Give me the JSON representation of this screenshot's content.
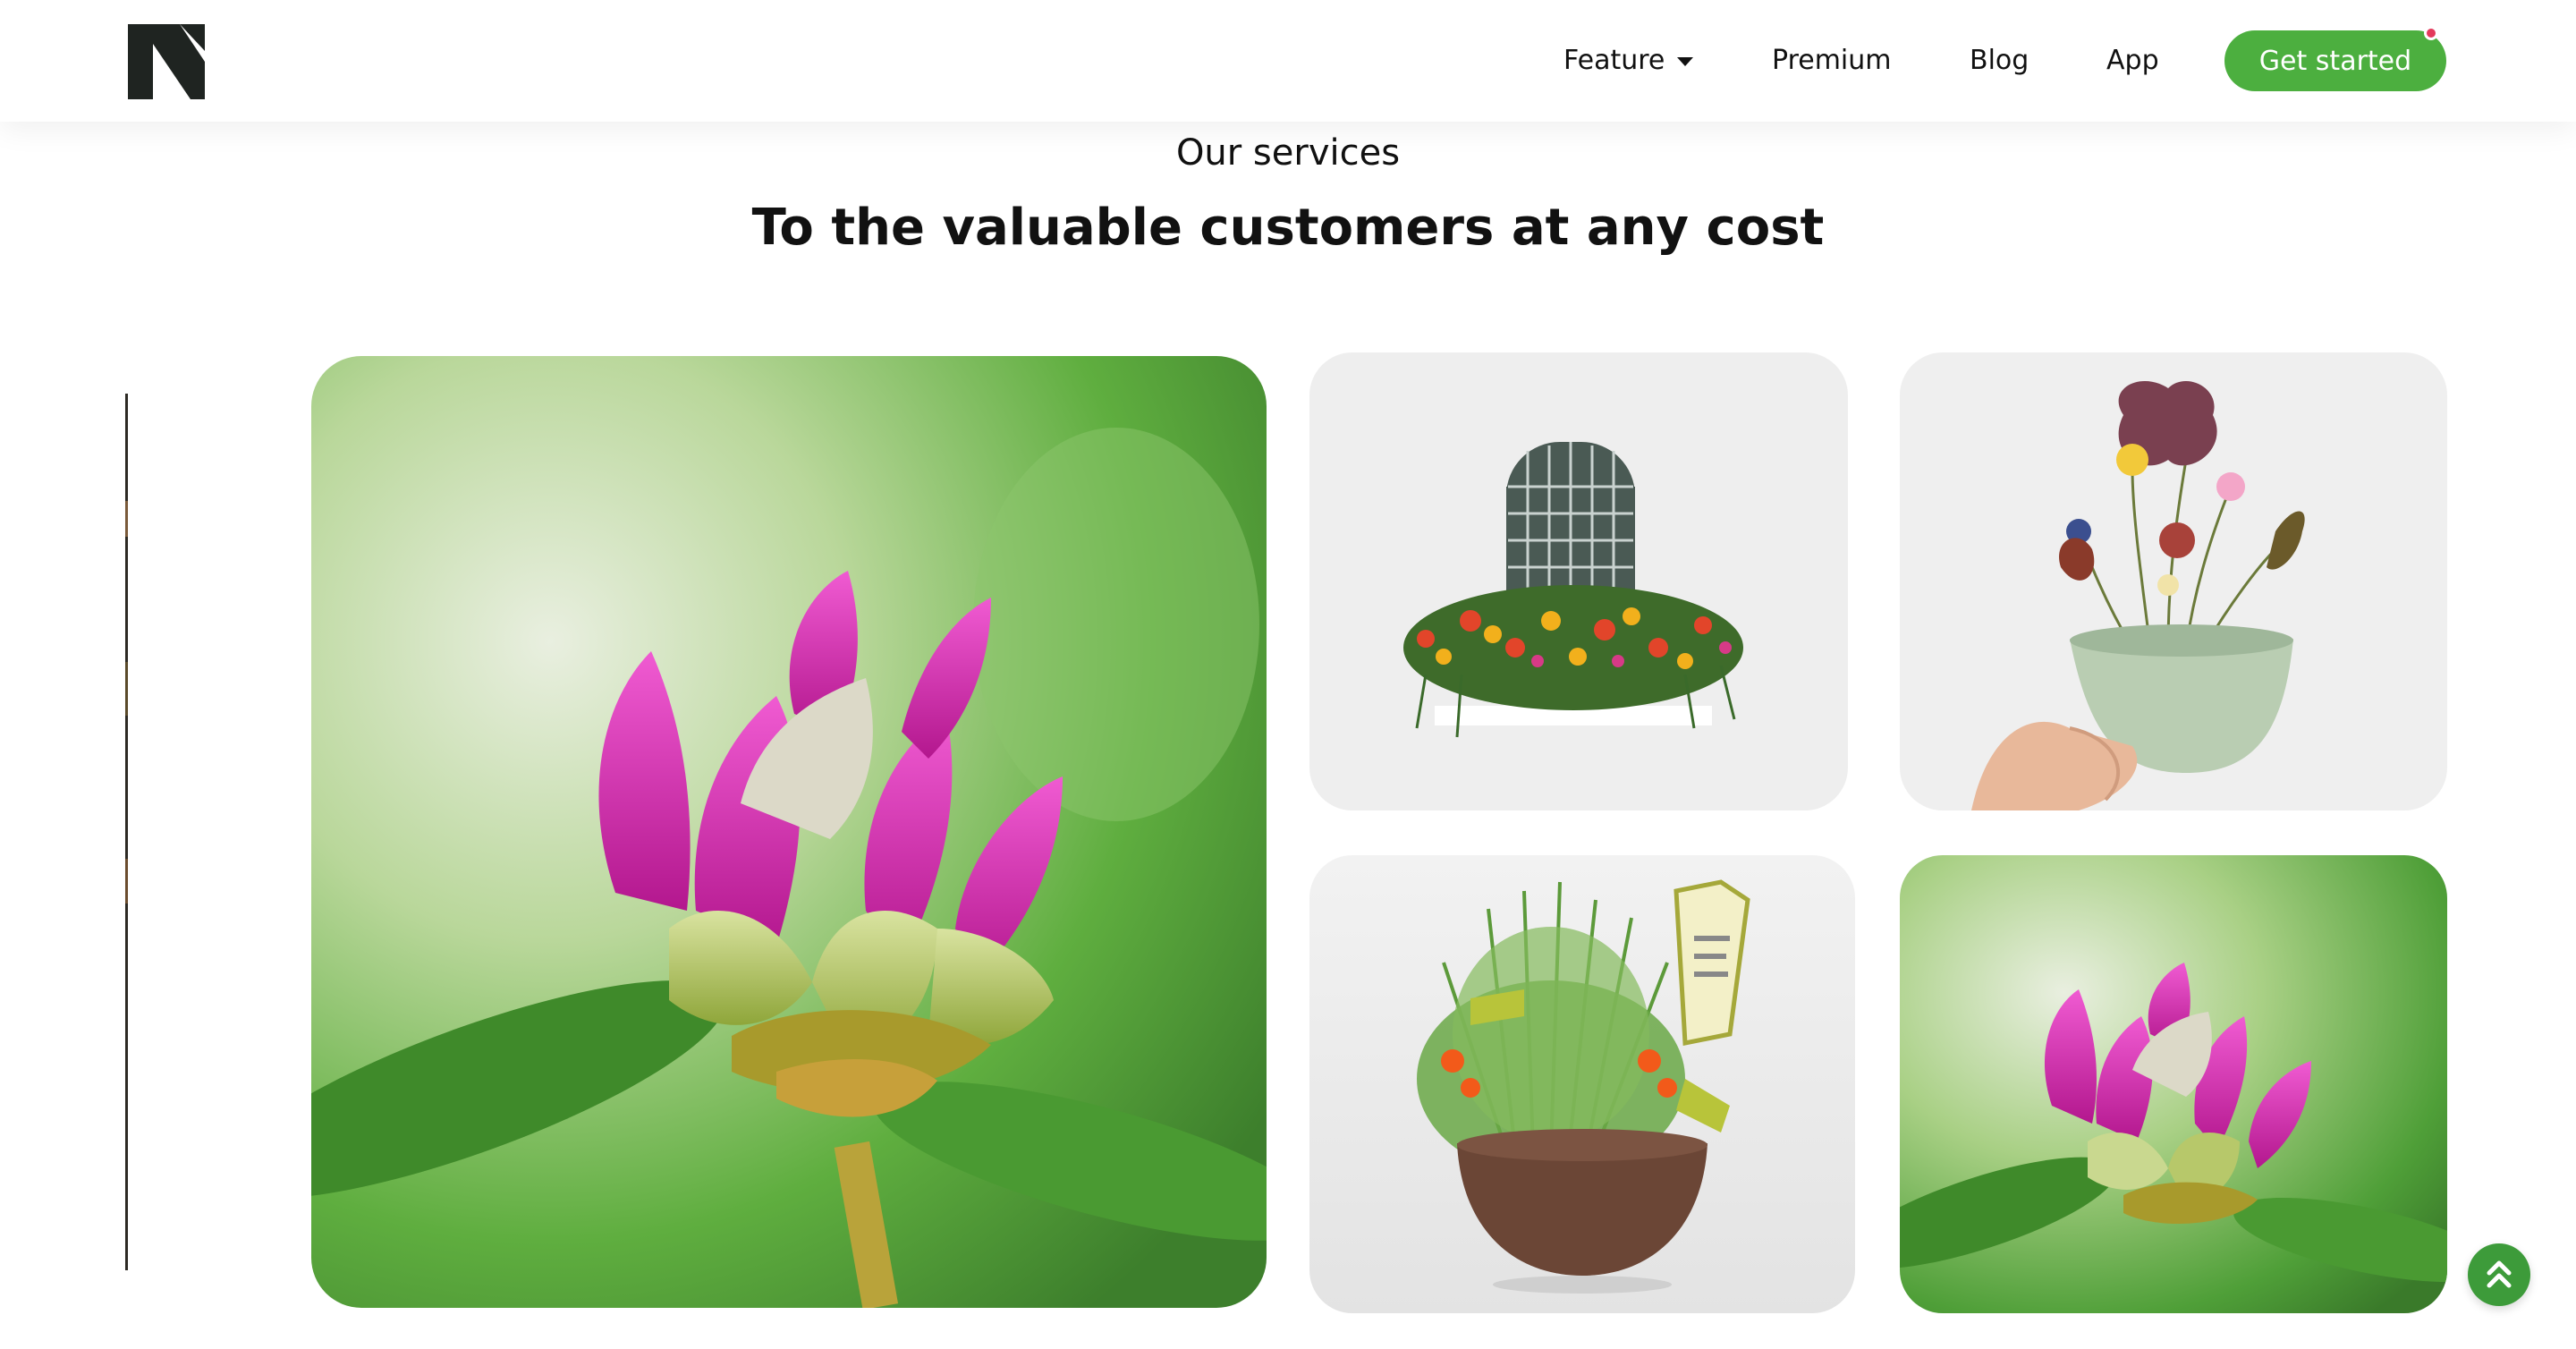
{
  "brand": {
    "logo_icon": "n-logo-icon",
    "color": "#1f2421"
  },
  "nav": {
    "items": [
      {
        "label": "Feature",
        "has_dropdown": true
      },
      {
        "label": "Premium"
      },
      {
        "label": "Blog"
      },
      {
        "label": "App"
      }
    ],
    "cta_label": "Get started",
    "cta_color": "#4caf3f",
    "notification_color": "#e33a5b"
  },
  "services": {
    "eyebrow": "Our services",
    "headline": "To the valuable customers at any cost"
  },
  "gallery": {
    "images": [
      {
        "name": "pink-rhododendron-bud-large",
        "icon": "flower-photo"
      },
      {
        "name": "window-flower-box",
        "icon": "flower-photo"
      },
      {
        "name": "pressed-flowers-in-cup",
        "icon": "flower-photo"
      },
      {
        "name": "potted-herb-plant",
        "icon": "plant-photo"
      },
      {
        "name": "pink-rhododendron-bud-small",
        "icon": "flower-photo"
      }
    ]
  },
  "scroll_top": {
    "icon": "double-chevron-up-icon",
    "color": "#3d9b3a"
  }
}
